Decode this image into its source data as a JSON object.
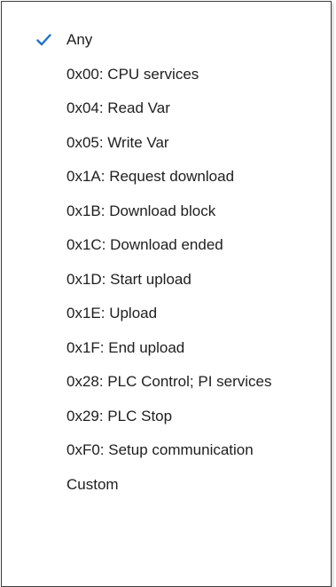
{
  "menu": {
    "accent_color": "#1e73c8",
    "items": [
      {
        "label": "Any",
        "checked": true,
        "icon": "checkmark-icon"
      },
      {
        "label": "0x00: CPU services"
      },
      {
        "label": "0x04: Read Var"
      },
      {
        "label": "0x05: Write Var"
      },
      {
        "label": "0x1A: Request download"
      },
      {
        "label": "0x1B: Download block"
      },
      {
        "label": "0x1C: Download ended"
      },
      {
        "label": "0x1D: Start upload"
      },
      {
        "label": "0x1E: Upload"
      },
      {
        "label": "0x1F: End upload"
      },
      {
        "label": "0x28: PLC Control; PI services"
      },
      {
        "label": "0x29: PLC Stop"
      },
      {
        "label": "0xF0: Setup communication"
      },
      {
        "label": "Custom"
      }
    ]
  }
}
